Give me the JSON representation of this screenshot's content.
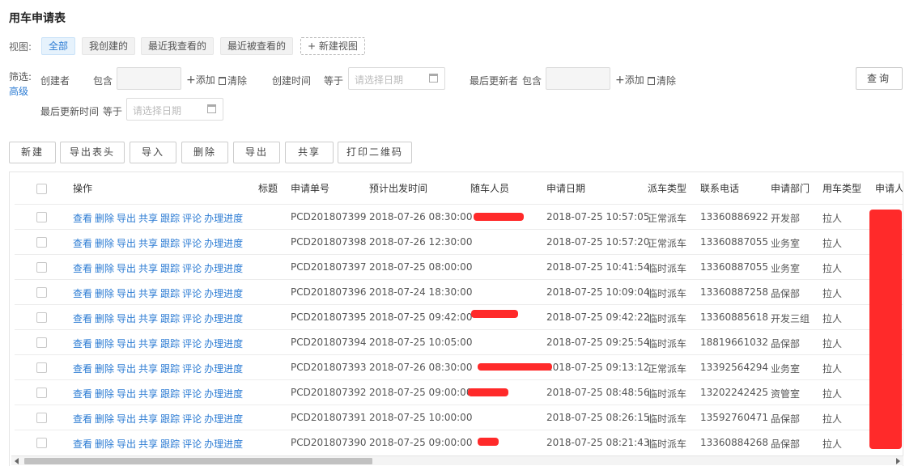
{
  "page_title": "用车申请表",
  "views": {
    "label": "视图:",
    "items": [
      "全部",
      "我创建的",
      "最近我查看的",
      "最近被查看的",
      "+ 新建视图"
    ]
  },
  "filters": {
    "label": "筛选:",
    "advanced": "高级",
    "creator_label": "创建者",
    "contains1": "包含",
    "add": "添加",
    "clear": "清除",
    "created_time_label": "创建时间",
    "equals1": "等于",
    "date_placeholder": "请选择日期",
    "last_updater_label": "最后更新者",
    "contains2": "包含",
    "last_update_time_label": "最后更新时间",
    "equals2": "等于",
    "query": "查询"
  },
  "toolbar": [
    "新建",
    "导出表头",
    "导入",
    "删除",
    "导出",
    "共享",
    "打印二维码"
  ],
  "table": {
    "headers": [
      "操作",
      "标题",
      "申请单号",
      "预计出发时间",
      "随车人员",
      "申请日期",
      "派车类型",
      "联系电话",
      "申请部门",
      "用车类型",
      "申请人"
    ],
    "ops": [
      "查看",
      "删除",
      "导出",
      "共享",
      "跟踪",
      "评论",
      "办理进度"
    ],
    "rows": [
      {
        "no": "PCD201807399",
        "depart": "2018-07-26 08:30:00",
        "apply": "2018-07-25 10:57:05",
        "dispatch": "正常派车",
        "phone": "13360886922",
        "dept": "开发部",
        "usage": "拉人"
      },
      {
        "no": "PCD201807398",
        "depart": "2018-07-26 12:30:00",
        "apply": "2018-07-25 10:57:20",
        "dispatch": "正常派车",
        "phone": "13360887055",
        "dept": "业务室",
        "usage": "拉人"
      },
      {
        "no": "PCD201807397",
        "depart": "2018-07-25 08:00:00",
        "apply": "2018-07-25 10:41:54",
        "dispatch": "临时派车",
        "phone": "13360887055",
        "dept": "业务室",
        "usage": "拉人"
      },
      {
        "no": "PCD201807396",
        "depart": "2018-07-24 18:30:00",
        "apply": "2018-07-25 10:09:04",
        "dispatch": "临时派车",
        "phone": "13360887258",
        "dept": "品保部",
        "usage": "拉人"
      },
      {
        "no": "PCD201807395",
        "depart": "2018-07-25 09:42:00",
        "apply": "2018-07-25 09:42:22",
        "dispatch": "临时派车",
        "phone": "13360885618",
        "dept": "开发三组",
        "usage": "拉人"
      },
      {
        "no": "PCD201807394",
        "depart": "2018-07-25 10:05:00",
        "apply": "2018-07-25 09:25:54",
        "dispatch": "临时派车",
        "phone": "18819661032",
        "dept": "品保部",
        "usage": "拉人"
      },
      {
        "no": "PCD201807393",
        "depart": "2018-07-26 08:30:00",
        "apply": "2018-07-25 09:13:12",
        "dispatch": "正常派车",
        "phone": "13392564294",
        "dept": "业务室",
        "usage": "拉人"
      },
      {
        "no": "PCD201807392",
        "depart": "2018-07-25 09:00:00",
        "apply": "2018-07-25 08:48:56",
        "dispatch": "临时派车",
        "phone": "13202242425",
        "dept": "资管室",
        "usage": "拉人"
      },
      {
        "no": "PCD201807391",
        "depart": "2018-07-25 10:00:00",
        "apply": "2018-07-25 08:26:15",
        "dispatch": "临时派车",
        "phone": "13592760471",
        "dept": "品保部",
        "usage": "拉人"
      },
      {
        "no": "PCD201807390",
        "depart": "2018-07-25 09:00:00",
        "apply": "2018-07-25 08:21:43",
        "dispatch": "临时派车",
        "phone": "13360884268",
        "dept": "品保部",
        "usage": "拉人"
      }
    ]
  },
  "colors": {
    "link": "#2b7bd3",
    "redaction": "#ff2a2a",
    "active_view_bg": "#e6f2fc"
  }
}
